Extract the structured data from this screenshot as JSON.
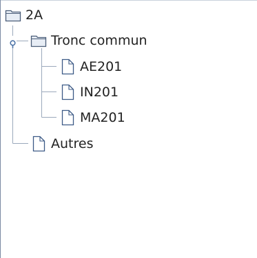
{
  "tree": {
    "root": {
      "label": "2A",
      "icon": "folder-closed-icon"
    },
    "group": {
      "label": "Tronc commun",
      "icon": "folder-closed-icon",
      "expanded": true,
      "toggle_icon": "expanded-handle-icon",
      "children": [
        {
          "label": "AE201",
          "icon": "file-icon"
        },
        {
          "label": "IN201",
          "icon": "file-icon"
        },
        {
          "label": "MA201",
          "icon": "file-icon"
        }
      ]
    },
    "other": {
      "label": "Autres",
      "icon": "file-icon"
    }
  },
  "colors": {
    "line": "#9aa8bb",
    "handle": "#4d74a8",
    "folder_stroke": "#4a5d78",
    "folder_fill": "#e7edf5",
    "file_stroke": "#3c5a86",
    "file_fill": "#ffffff"
  }
}
